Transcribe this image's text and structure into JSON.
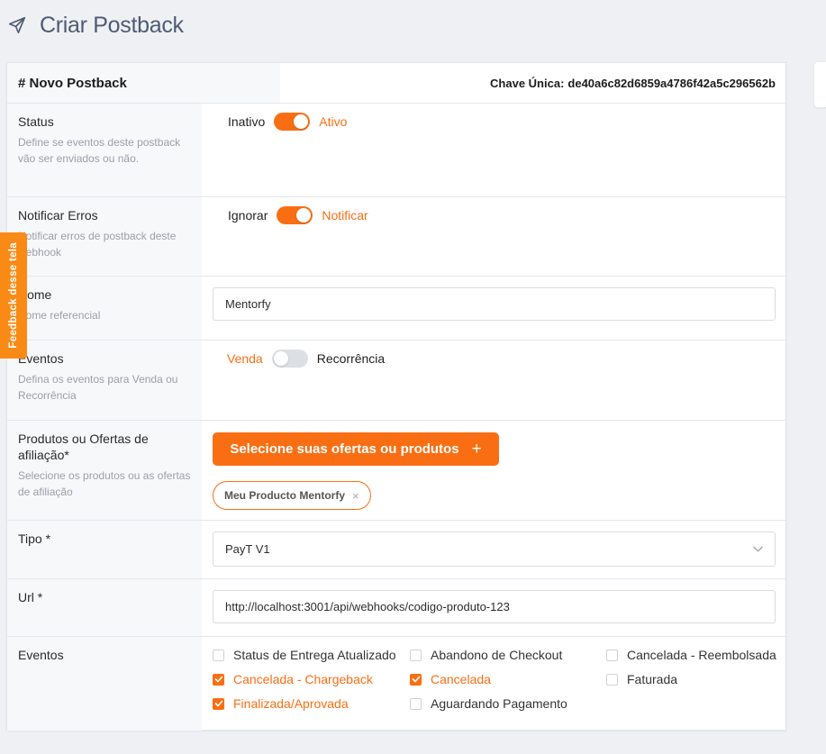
{
  "page": {
    "title": "Criar Postback",
    "icon": "send-icon"
  },
  "card": {
    "header_title": "# Novo Postback",
    "key_label": "Chave Única:",
    "key_value": "de40a6c82d6859a4786f42a5c296562b"
  },
  "status": {
    "title": "Status",
    "desc": "Define se eventos deste postback vão ser enviados ou não.",
    "off_label": "Inativo",
    "on_label": "Ativo",
    "enabled": true
  },
  "notify": {
    "title": "Notificar Erros",
    "desc": "Notificar erros de postback deste webhook",
    "off_label": "Ignorar",
    "on_label": "Notificar",
    "enabled": true
  },
  "name": {
    "title": "Nome",
    "desc": "Nome referencial",
    "value": "Mentorfy"
  },
  "events_type": {
    "title": "Eventos",
    "desc": "Defina os eventos para Venda ou Recorrência",
    "left_label": "Venda",
    "right_label": "Recorrência",
    "recurrence_enabled": false
  },
  "products": {
    "title": "Produtos ou Ofertas de afiliação*",
    "desc": "Selecione os produtos ou as ofertas de afiliação",
    "button_label": "Selecione suas ofertas ou produtos",
    "button_icon": "+",
    "chip_label": "Meu Producto Mentorfy",
    "chip_close": "×"
  },
  "tipo": {
    "title": "Tipo *",
    "selected": "PayT V1"
  },
  "url": {
    "title": "Url *",
    "value": "http://localhost:3001/api/webhooks/codigo-produto-123"
  },
  "events": {
    "title": "Eventos",
    "options": [
      {
        "label": "Status de Entrega Atualizado",
        "checked": false
      },
      {
        "label": "Abandono de Checkout",
        "checked": false
      },
      {
        "label": "Cancelada - Reembolsada",
        "checked": false
      },
      {
        "label": "Cancelada - Chargeback",
        "checked": true
      },
      {
        "label": "Cancelada",
        "checked": true
      },
      {
        "label": "Faturada",
        "checked": false
      },
      {
        "label": "Finalizada/Aprovada",
        "checked": true
      },
      {
        "label": "Aguardando Pagamento",
        "checked": false
      }
    ]
  },
  "feedback_tab": {
    "label": "Feedback desse tela"
  },
  "colors": {
    "accent": "#fa6e13",
    "toggle_off": "#dcdfe4",
    "title": "#4e5b73"
  }
}
